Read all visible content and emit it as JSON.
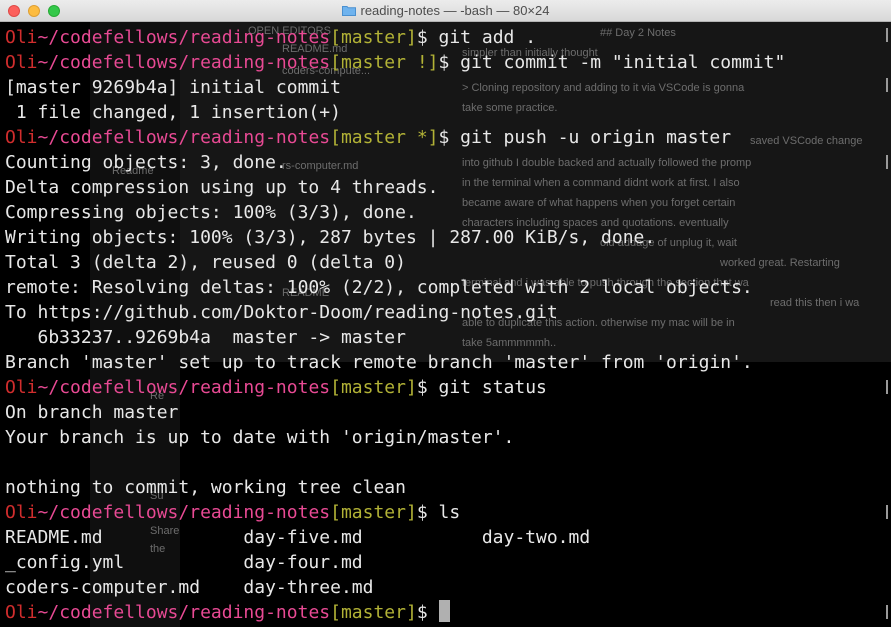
{
  "window": {
    "title": "reading-notes — -bash — 80×24"
  },
  "prompt": {
    "user": "Oli",
    "path": "~/codefellows/reading-notes"
  },
  "lines": [
    {
      "type": "prompt",
      "branch": "[master]",
      "sym": "$",
      "cmd": " git add ."
    },
    {
      "type": "prompt",
      "branch": "[master !]",
      "sym": "$",
      "cmd": " git commit -m \"initial commit\""
    },
    {
      "type": "out",
      "text": "[master 9269b4a] initial commit"
    },
    {
      "type": "out",
      "text": " 1 file changed, 1 insertion(+)"
    },
    {
      "type": "prompt",
      "branch": "[master *]",
      "sym": "$",
      "cmd": " git push -u origin master"
    },
    {
      "type": "out",
      "text": "Counting objects: 3, done."
    },
    {
      "type": "out",
      "text": "Delta compression using up to 4 threads."
    },
    {
      "type": "out",
      "text": "Compressing objects: 100% (3/3), done."
    },
    {
      "type": "out",
      "text": "Writing objects: 100% (3/3), 287 bytes | 287.00 KiB/s, done."
    },
    {
      "type": "out",
      "text": "Total 3 (delta 2), reused 0 (delta 0)"
    },
    {
      "type": "out",
      "text": "remote: Resolving deltas: 100% (2/2), completed with 2 local objects."
    },
    {
      "type": "out",
      "text": "To https://github.com/Doktor-Doom/reading-notes.git"
    },
    {
      "type": "out",
      "text": "   6b33237..9269b4a  master -> master"
    },
    {
      "type": "out",
      "text": "Branch 'master' set up to track remote branch 'master' from 'origin'."
    },
    {
      "type": "prompt",
      "branch": "[master]",
      "sym": "$",
      "cmd": " git status"
    },
    {
      "type": "out",
      "text": "On branch master"
    },
    {
      "type": "out",
      "text": "Your branch is up to date with 'origin/master'."
    },
    {
      "type": "out",
      "text": ""
    },
    {
      "type": "out",
      "text": "nothing to commit, working tree clean"
    },
    {
      "type": "prompt",
      "branch": "[master]",
      "sym": "$",
      "cmd": " ls"
    },
    {
      "type": "out",
      "text": "README.md             day-five.md           day-two.md"
    },
    {
      "type": "out",
      "text": "_config.yml           day-four.md"
    },
    {
      "type": "out",
      "text": "coders-computer.md    day-three.md"
    },
    {
      "type": "prompt",
      "branch": "[master]",
      "sym": "$",
      "cmd": " ",
      "cursor": true
    }
  ],
  "background": {
    "editor_lines": [
      "## Day 2 Notes",
      "simpler than initially thought",
      "> Cloning repository and adding to it via VSCode is gonna",
      "take some practice.",
      "saved VSCode change",
      "into github I double backed and actually followed the promp",
      "in the terminal when a command didnt work at first. I also",
      "became aware of what happens when you forget certain",
      "characters including spaces and quotations. eventually",
      "old addage of unplug it, wait",
      "worked great. Restarting",
      "terminal and i was able to push through the section that wa",
      "read this then i wa",
      "able to duplicate this action. otherwise my mac will be in",
      "take 5ammmmmh.."
    ],
    "sidebar_labels": [
      "OPEN EDITORS",
      "README.md",
      "coders-compute...",
      "rs-computer.md",
      "Readme",
      "README",
      "Re",
      "Su",
      "Share",
      "the"
    ]
  }
}
